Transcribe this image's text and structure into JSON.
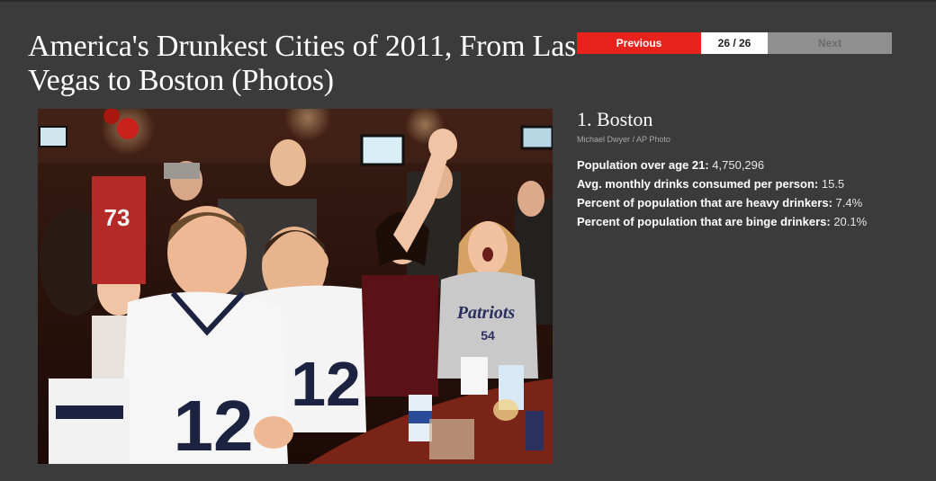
{
  "page": {
    "title": "America's Drunkest Cities of 2011, From Las Vegas to Boston (Photos)"
  },
  "pager": {
    "previous_label": "Previous",
    "count": "26 / 26",
    "next_label": "Next"
  },
  "slide": {
    "title": "1. Boston",
    "credit": "Michael Dwyer / AP Photo",
    "stats": [
      {
        "label": "Population over age 21:",
        "value": "4,750,296"
      },
      {
        "label": "Avg. monthly drinks consumed per person:",
        "value": "15.5"
      },
      {
        "label": "Percent of population that are heavy drinkers:",
        "value": "7.4%"
      },
      {
        "label": "Percent of population that are binge drinkers:",
        "value": "20.1%"
      }
    ]
  },
  "photo": {
    "jersey_number": "12",
    "jersey_number_back": "73",
    "shirt_text": "Patriots",
    "shirt_number": "54"
  },
  "colors": {
    "background": "#3b3b3b",
    "accent_red": "#e8231d",
    "next_disabled": "#8f8f8f"
  }
}
